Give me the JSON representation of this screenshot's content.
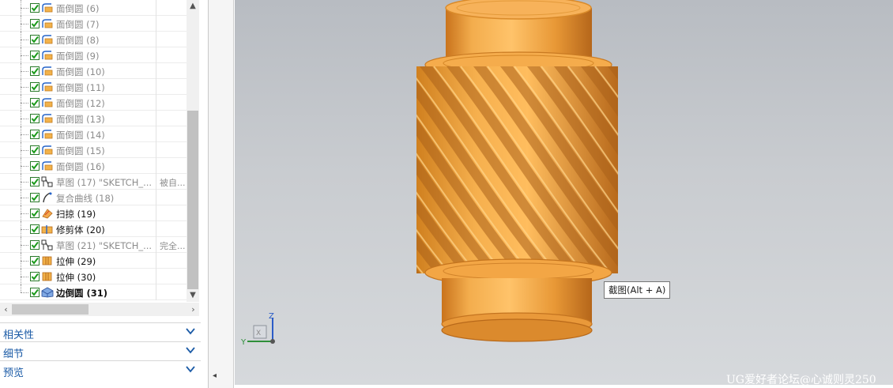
{
  "navigator": {
    "features": [
      {
        "name": "面倒圆 (6)",
        "icon": "face-blend-icon",
        "comment": "",
        "state": "inactive"
      },
      {
        "name": "面倒圆 (7)",
        "icon": "face-blend-icon",
        "comment": "",
        "state": "inactive"
      },
      {
        "name": "面倒圆 (8)",
        "icon": "face-blend-icon",
        "comment": "",
        "state": "inactive"
      },
      {
        "name": "面倒圆 (9)",
        "icon": "face-blend-icon",
        "comment": "",
        "state": "inactive"
      },
      {
        "name": "面倒圆 (10)",
        "icon": "face-blend-icon",
        "comment": "",
        "state": "inactive"
      },
      {
        "name": "面倒圆 (11)",
        "icon": "face-blend-icon",
        "comment": "",
        "state": "inactive"
      },
      {
        "name": "面倒圆 (12)",
        "icon": "face-blend-icon",
        "comment": "",
        "state": "inactive"
      },
      {
        "name": "面倒圆 (13)",
        "icon": "face-blend-icon",
        "comment": "",
        "state": "inactive"
      },
      {
        "name": "面倒圆 (14)",
        "icon": "face-blend-icon",
        "comment": "",
        "state": "inactive"
      },
      {
        "name": "面倒圆 (15)",
        "icon": "face-blend-icon",
        "comment": "",
        "state": "inactive"
      },
      {
        "name": "面倒圆 (16)",
        "icon": "face-blend-icon",
        "comment": "",
        "state": "inactive"
      },
      {
        "name": "草图 (17) \"SKETCH_...",
        "icon": "sketch-icon",
        "comment": "被自...",
        "state": "inactive"
      },
      {
        "name": "复合曲线 (18)",
        "icon": "composite-curve-icon",
        "comment": "",
        "state": "inactive"
      },
      {
        "name": "扫掠 (19)",
        "icon": "swept-icon",
        "comment": "",
        "state": "active"
      },
      {
        "name": "修剪体 (20)",
        "icon": "trim-body-icon",
        "comment": "",
        "state": "active"
      },
      {
        "name": "草图 (21) \"SKETCH_...",
        "icon": "sketch-icon",
        "comment": "完全...",
        "state": "inactive"
      },
      {
        "name": "拉伸 (29)",
        "icon": "extrude-icon",
        "comment": "",
        "state": "active"
      },
      {
        "name": "拉伸 (30)",
        "icon": "extrude-icon",
        "comment": "",
        "state": "active"
      },
      {
        "name": "边倒圆 (31)",
        "icon": "edge-blend-icon",
        "comment": "",
        "state": "current"
      }
    ],
    "panels": [
      {
        "label": "相关性"
      },
      {
        "label": "细节"
      },
      {
        "label": "预览"
      }
    ]
  },
  "graphics": {
    "tooltip": "截图(Alt + A)",
    "triad": {
      "x": "X",
      "y": "Y",
      "z": "Z"
    },
    "model_color": "#f0a33c"
  },
  "watermark": "UG爱好者论坛@心诚则灵250"
}
